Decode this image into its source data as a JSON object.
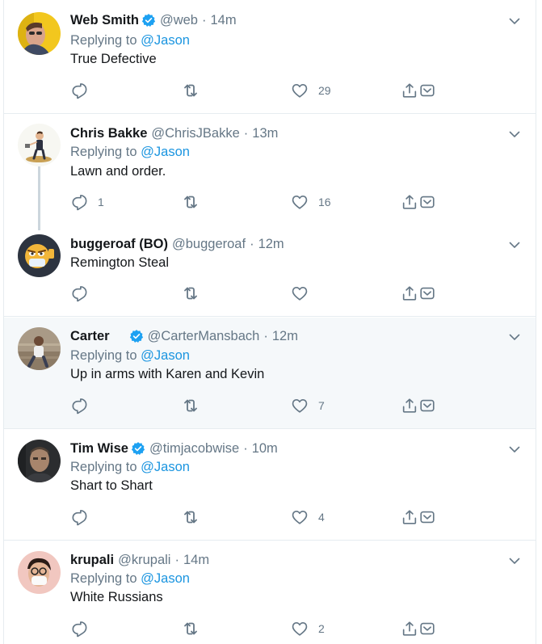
{
  "tweets": [
    {
      "name": "Web Smith",
      "verified": true,
      "handle": "@web",
      "time": "14m",
      "replying_prefix": "Replying to",
      "replying_to": "@Jason",
      "text": "True Defective",
      "replies": "",
      "retweets": "",
      "likes": "29"
    },
    {
      "name": "Chris Bakke",
      "verified": false,
      "handle": "@ChrisJBakke",
      "time": "13m",
      "replying_prefix": "Replying to",
      "replying_to": "@Jason",
      "text": "Lawn and order.",
      "replies": "1",
      "retweets": "",
      "likes": "16"
    },
    {
      "name": "buggeroaf (BO)",
      "verified": false,
      "handle": "@buggeroaf",
      "time": "12m",
      "text": "Remington Steal",
      "replies": "",
      "retweets": "",
      "likes": ""
    },
    {
      "name": "Carter",
      "verified": true,
      "handle": "@CarterMansbach",
      "time": "12m",
      "replying_prefix": "Replying to",
      "replying_to": "@Jason",
      "text": "Up in arms with Karen and Kevin",
      "replies": "",
      "retweets": "",
      "likes": "7"
    },
    {
      "name": "Tim Wise",
      "verified": true,
      "handle": "@timjacobwise",
      "time": "10m",
      "replying_prefix": "Replying to",
      "replying_to": "@Jason",
      "text": "Shart to Shart",
      "replies": "",
      "retweets": "",
      "likes": "4"
    },
    {
      "name": "krupali",
      "verified": false,
      "handle": "@krupali",
      "time": "14m",
      "replying_prefix": "Replying to",
      "replying_to": "@Jason",
      "text": "White Russians",
      "replies": "",
      "retweets": "",
      "likes": "2"
    }
  ],
  "colors": {
    "accent": "#1b95e0",
    "verified": "#1da1f2",
    "secondary_text": "#657786",
    "highlight_bg": "#f5f8fa",
    "icon": "#657786"
  },
  "icons": {
    "reply": "reply-icon",
    "retweet": "retweet-icon",
    "like": "heart-icon",
    "share": "share-icon",
    "dm": "dm-icon",
    "menu": "chevron-down-icon",
    "verified": "verified-badge-icon"
  }
}
